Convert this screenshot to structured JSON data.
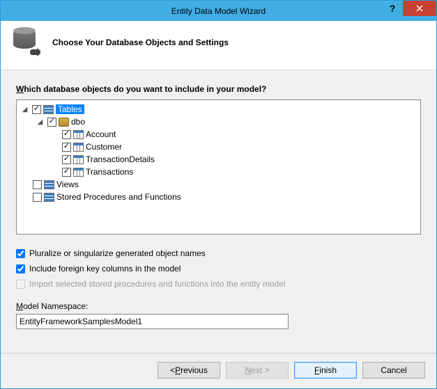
{
  "window": {
    "title": "Entity Data Model Wizard"
  },
  "header": {
    "title": "Choose Your Database Objects and Settings"
  },
  "prompt": {
    "pre": "W",
    "rest": "hich database objects do you want to include in your model?"
  },
  "tree": {
    "root": {
      "label": "Tables",
      "schema": {
        "label": "dbo",
        "tables": [
          {
            "label": "Account"
          },
          {
            "label": "Customer"
          },
          {
            "label": "TransactionDetails"
          },
          {
            "label": "Transactions"
          }
        ]
      }
    },
    "views": {
      "label": "Views"
    },
    "sprocs": {
      "label": "Stored Procedures and Functions"
    }
  },
  "options": {
    "pluralize_pre": "Pluralize or ",
    "pluralize_u": "s",
    "pluralize_post": "ingularize generated object names",
    "fk_pre": "Include foreign ",
    "fk_u": "k",
    "fk_post": "ey columns in the model",
    "import_pre": "",
    "import_u": "I",
    "import_post": "mport selected stored procedures and functions into the entity model"
  },
  "namespace": {
    "label_u": "M",
    "label_rest": "odel Namespace:",
    "value": "EntityFrameworkSamplesModel1"
  },
  "buttons": {
    "prev": "< ",
    "prev_u": "P",
    "prev_post": "revious",
    "next_u": "N",
    "next_post": "ext >",
    "finish_u": "F",
    "finish_post": "inish",
    "cancel": "Cancel"
  }
}
